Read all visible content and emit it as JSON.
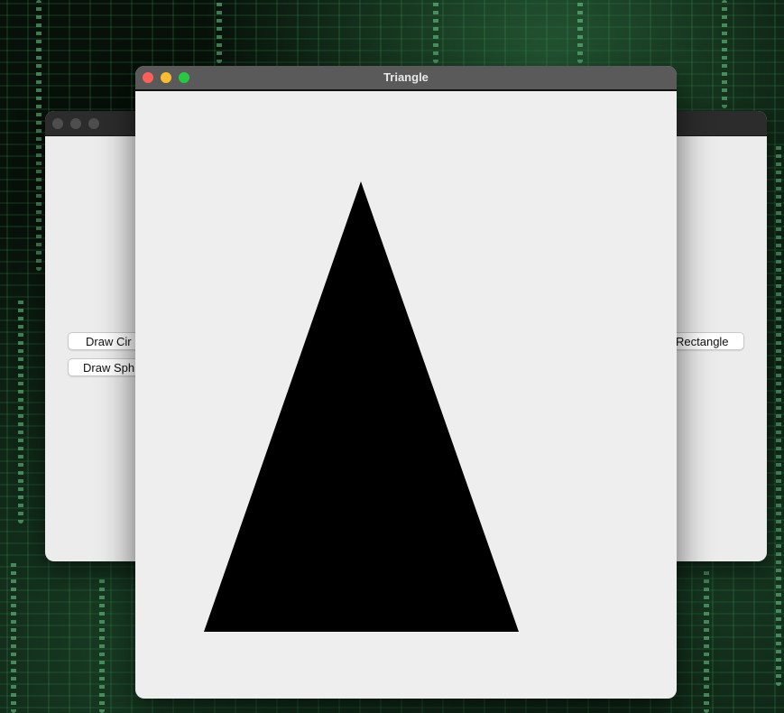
{
  "front_window": {
    "title": "Triangle",
    "controls": {
      "close_color": "#ff5f57",
      "minimize_color": "#febc2e",
      "zoom_color": "#28c840"
    },
    "shape": {
      "kind": "triangle",
      "fill": "#000000"
    }
  },
  "back_window": {
    "buttons": {
      "draw_circle": "Draw Cir",
      "draw_sphere": "Draw Sph",
      "draw_rectangle": "Rectangle"
    }
  }
}
